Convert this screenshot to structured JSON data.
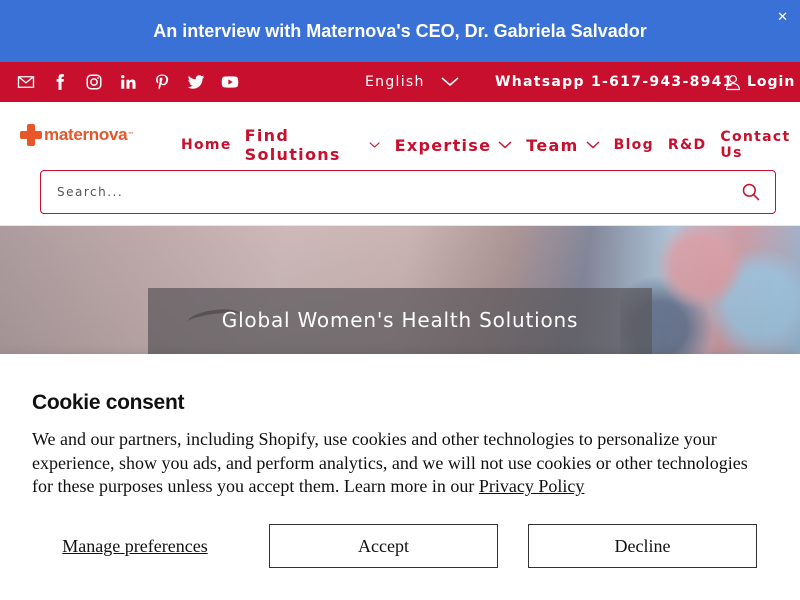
{
  "announcement": {
    "text": "An interview with Maternova's CEO, Dr. Gabriela Salvador",
    "close_glyph": "✕"
  },
  "topbar": {
    "social_icons": [
      "email-icon",
      "facebook-icon",
      "instagram-icon",
      "linkedin-icon",
      "pinterest-icon",
      "twitter-icon",
      "youtube-icon"
    ],
    "language": "English",
    "whatsapp": "Whatsapp 1-617-943-8941",
    "login": "Login",
    "bg_color": "#c8102e"
  },
  "header": {
    "logo_text": "maternova",
    "logo_superscript": "™",
    "nav": [
      {
        "label": "Home",
        "dropdown": false
      },
      {
        "label": "Find Solutions",
        "dropdown": true
      },
      {
        "label": "Expertise",
        "dropdown": true
      },
      {
        "label": "Team",
        "dropdown": true
      },
      {
        "label": "Blog",
        "dropdown": false
      },
      {
        "label": "R&D",
        "dropdown": false
      },
      {
        "label": "Contact Us",
        "dropdown": false
      }
    ],
    "search_placeholder": "Search...",
    "accent_color": "#c8102e"
  },
  "hero": {
    "title": "Global Women's Health Solutions"
  },
  "cookie": {
    "title": "Cookie consent",
    "body": "We and our partners, including Shopify, use cookies and other technologies to personalize your experience, show you ads, and perform analytics, and we will not use cookies or other technologies for these purposes unless you accept them. Learn more in our ",
    "policy_link": "Privacy Policy",
    "manage_label": "Manage preferences",
    "accept_label": "Accept",
    "decline_label": "Decline"
  },
  "announcement_color": "#3a71d6"
}
